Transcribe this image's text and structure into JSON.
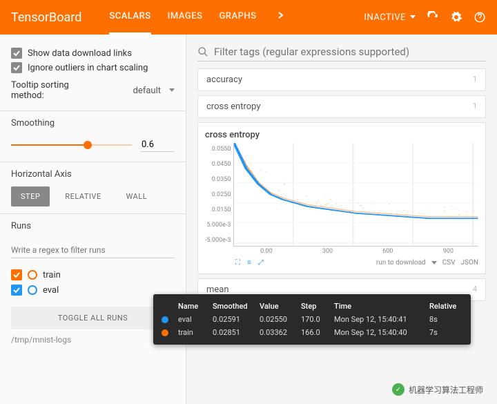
{
  "header": {
    "title": "TensorBoard",
    "tabs": [
      "SCALARS",
      "IMAGES",
      "GRAPHS"
    ],
    "inactive": "INACTIVE"
  },
  "sidebar": {
    "opt1": "Show data download links",
    "opt2": "Ignore outliers in chart scaling",
    "tooltip_label": "Tooltip sorting method:",
    "tooltip_val": "default",
    "smoothing": "Smoothing",
    "smoothing_val": "0.6",
    "haxis": "Horizontal Axis",
    "axis": [
      "STEP",
      "RELATIVE",
      "WALL"
    ],
    "runs": "Runs",
    "runs_ph": "Write a regex to filter runs",
    "run_list": [
      "train",
      "eval"
    ],
    "toggle": "TOGGLE ALL RUNS",
    "path": "/tmp/mnist-logs"
  },
  "main": {
    "search_ph": "Filter tags (regular expressions supported)",
    "cards": [
      {
        "t": "accuracy",
        "c": "1"
      },
      {
        "t": "cross entropy",
        "c": "1"
      }
    ],
    "mean": "mean",
    "download": {
      "run": "run to download",
      "csv": "CSV",
      "json": "JSON"
    }
  },
  "chart_data": {
    "type": "line",
    "title": "cross entropy",
    "ylabel": "",
    "xlabel": "",
    "yticks": [
      "0.0550",
      "0.0450",
      "0.0350",
      "0.0250",
      "0.0150",
      "5.000e-3",
      "-5.000e-3"
    ],
    "xticks": [
      "0.00",
      "300",
      "600",
      "900"
    ],
    "ylim": [
      -0.005,
      0.055
    ],
    "xlim": [
      0,
      1000
    ],
    "series": [
      {
        "name": "train",
        "color": "#ff6f00",
        "x": [
          0,
          50,
          100,
          150,
          200,
          300,
          400,
          500,
          600,
          700,
          800,
          900,
          1000
        ],
        "y": [
          0.055,
          0.042,
          0.032,
          0.026,
          0.023,
          0.019,
          0.017,
          0.015,
          0.014,
          0.013,
          0.012,
          0.012,
          0.012
        ]
      },
      {
        "name": "eval",
        "color": "#2196f3",
        "x": [
          0,
          50,
          100,
          150,
          200,
          300,
          400,
          500,
          600,
          700,
          800,
          900,
          1000
        ],
        "y": [
          0.055,
          0.04,
          0.031,
          0.025,
          0.022,
          0.018,
          0.016,
          0.014,
          0.013,
          0.012,
          0.011,
          0.011,
          0.011
        ]
      }
    ]
  },
  "tooltip": {
    "headers": [
      "Name",
      "Smoothed",
      "Value",
      "Step",
      "Time",
      "Relative"
    ],
    "rows": [
      {
        "color": "#2196f3",
        "name": "eval",
        "smoothed": "0.02591",
        "value": "0.02550",
        "step": "170.0",
        "time": "Mon Sep 12, 15:40:41",
        "rel": "8s"
      },
      {
        "color": "#ff6f00",
        "name": "train",
        "smoothed": "0.02851",
        "value": "0.03362",
        "step": "166.0",
        "time": "Mon Sep 12, 15:40:40",
        "rel": "7s"
      }
    ]
  },
  "watermark": "机器学习算法工程师"
}
